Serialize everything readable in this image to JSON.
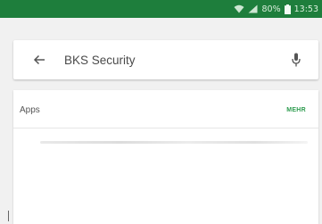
{
  "status_bar": {
    "battery_percent": "80%",
    "time": "13:53",
    "background": "#1e7e3c"
  },
  "search": {
    "query": "BKS Security",
    "back_icon": "arrow-back-icon",
    "mic_icon": "microphone-icon"
  },
  "apps_section": {
    "title": "Apps",
    "more_label": "MEHR",
    "accent": "#2e9c4f"
  }
}
